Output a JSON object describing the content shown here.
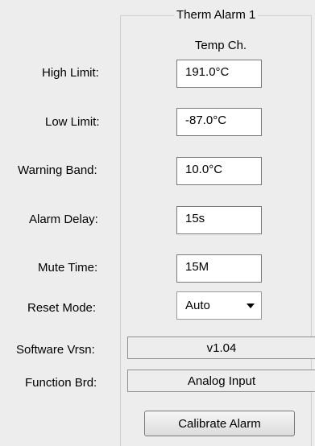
{
  "panel": {
    "group_title": "Therm Alarm 1",
    "column_header": "Temp Ch."
  },
  "fields": {
    "high_limit": {
      "label": "High Limit:",
      "value": "191.0°C"
    },
    "low_limit": {
      "label": "Low Limit:",
      "value": "-87.0°C"
    },
    "warning_band": {
      "label": "Warning Band:",
      "value": "10.0°C"
    },
    "alarm_delay": {
      "label": "Alarm Delay:",
      "value": "15s"
    },
    "mute_time": {
      "label": "Mute Time:",
      "value": "15M"
    },
    "reset_mode": {
      "label": "Reset Mode:",
      "value": "Auto"
    },
    "software_version": {
      "label": "Software Vrsn:",
      "value": "v1.04"
    },
    "function_board": {
      "label": "Function Brd:",
      "value": "Analog Input"
    }
  },
  "actions": {
    "calibrate_label": "Calibrate Alarm"
  }
}
